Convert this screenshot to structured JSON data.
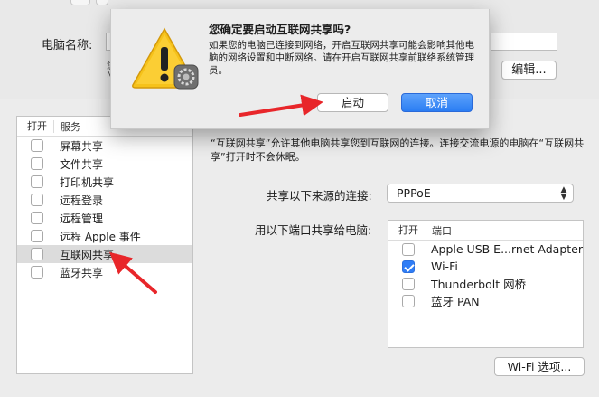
{
  "sharing": {
    "computer_name_label": "电脑名称:",
    "computer_name_value": "",
    "computer_name_hint_lines": [
      "您",
      "M"
    ],
    "edit_button": "编辑...",
    "services_header": {
      "on": "打开",
      "service": "服务"
    },
    "services": [
      {
        "label": "屏幕共享",
        "checked": false,
        "selected": false
      },
      {
        "label": "文件共享",
        "checked": false,
        "selected": false
      },
      {
        "label": "打印机共享",
        "checked": false,
        "selected": false
      },
      {
        "label": "远程登录",
        "checked": false,
        "selected": false
      },
      {
        "label": "远程管理",
        "checked": false,
        "selected": false
      },
      {
        "label": "远程 Apple 事件",
        "checked": false,
        "selected": false
      },
      {
        "label": "互联网共享",
        "checked": false,
        "selected": true
      },
      {
        "label": "蓝牙共享",
        "checked": false,
        "selected": false
      }
    ],
    "description": "“互联网共享”允许其他电脑共享您到互联网的连接。连接交流电源的电脑在“互联网共享”打开时不会休眠。",
    "share_from_label": "共享以下来源的连接:",
    "share_from_value": "PPPoE",
    "share_to_label": "用以下端口共享给电脑:",
    "ports_header": {
      "on": "打开",
      "port": "端口"
    },
    "ports": [
      {
        "label": "Apple USB E...rnet Adapter",
        "checked": false
      },
      {
        "label": "Wi-Fi",
        "checked": true
      },
      {
        "label": "Thunderbolt 网桥",
        "checked": false
      },
      {
        "label": "蓝牙 PAN",
        "checked": false
      }
    ],
    "wifi_options_button": "Wi-Fi 选项..."
  },
  "dialog": {
    "title": "您确定要启动互联网共享吗?",
    "body": "如果您的电脑已连接到网络，开启互联网共享可能会影响其他电脑的网络设置和中断网络。请在开启互联网共享前联络系统管理员。",
    "start_button": "启动",
    "cancel_button": "取消",
    "icon": "warning-icon"
  },
  "colors": {
    "accent": "#2f7df6",
    "arrow": "#e8262a",
    "warning_yellow": "#f6c21a"
  }
}
